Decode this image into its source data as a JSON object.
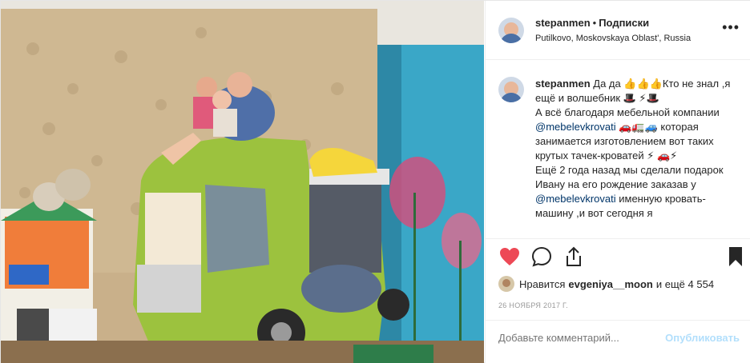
{
  "header": {
    "username": "stepanmen",
    "separator": "•",
    "follow_label": "Подписки",
    "location": "Putilkovo, Moskovskaya Oblast', Russia",
    "more_label": "•••"
  },
  "caption": {
    "username": "stepanmen",
    "text_1": "Да да 👍👍👍Кто не знал ,я ещё и волшебник 🎩 ⚡🎩",
    "text_2": "А всё благодаря мебельной компании",
    "mention_1": "@mebelevkrovati",
    "text_3": "🚗🚛🚙 которая занимается изготовлением вот таких крутых тачек-кроватей ⚡ 🚗⚡",
    "text_4": "Ещё 2 года назад мы сделали подарок Ивану на его рождение заказав у",
    "mention_2": "@mebelevkrovati",
    "text_5": "именную кровать-машину ,и вот сегодня я"
  },
  "likes": {
    "prefix": "Нравится",
    "user": "evgeniya__moon",
    "suffix": "и ещё 4 554"
  },
  "date": "26 НОЯБРЯ 2017 Г.",
  "comment_box": {
    "placeholder": "Добавьте комментарий...",
    "publish_label": "Опубликовать"
  },
  "colors": {
    "like": "#ed4956",
    "publish_disabled": "#b2dffc",
    "mention": "#003569"
  }
}
